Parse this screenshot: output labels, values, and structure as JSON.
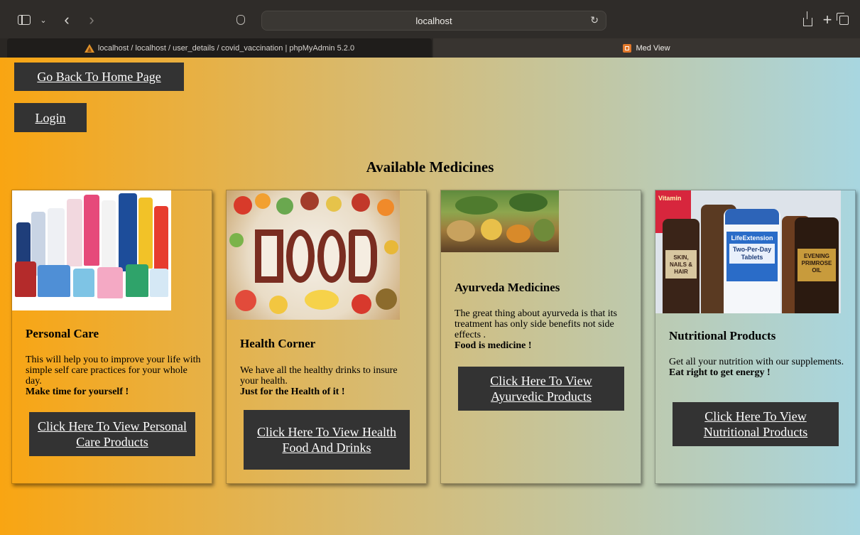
{
  "browser": {
    "address": "localhost",
    "tabs": [
      {
        "label": "localhost / localhost / user_details / covid_vaccination | phpMyAdmin 5.2.0",
        "active": false
      },
      {
        "label": "Med View",
        "active": true
      }
    ]
  },
  "nav": {
    "home_label": "Go Back To Home Page",
    "login_label": "Login"
  },
  "page_title": "Available Medicines",
  "cards": [
    {
      "heading": "Personal Care",
      "description": "This will help you to improve your life with simple self care practices for your whole day.",
      "tagline": "Make time for yourself !",
      "button": "Click Here To View Personal Care Products"
    },
    {
      "heading": "Health Corner",
      "description": "We have all the healthy drinks to insure your health.",
      "tagline": "Just for the Health of it !",
      "button": "Click Here To View Health Food And Drinks"
    },
    {
      "heading": "Ayurveda Medicines",
      "description": "The great thing about ayurveda is that its treatment has only side benefits not side effects .",
      "tagline": "Food is medicine !",
      "button": "Click Here To View Ayurvedic Products"
    },
    {
      "heading": "Nutritional Products",
      "description": "Get all your nutrition with our supplements.",
      "tagline": "Eat right to get energy !",
      "button": "Click Here To View Nutritional Products"
    }
  ],
  "images": {
    "food_word": "FOOD",
    "supplement_label_brand": "LifeExtension",
    "supplement_label_name": "Two-Per-Day Tablets",
    "supplement_label_left": "SKIN, NAILS & HAIR",
    "supplement_label_right": "EVENING PRIMROSE OIL",
    "supplement_label_top": "Vitamin"
  },
  "colors": {
    "gradient_left": "#f9a512",
    "gradient_right": "#a8d6e0",
    "button_bg": "#333333",
    "button_text": "#ffffff"
  }
}
